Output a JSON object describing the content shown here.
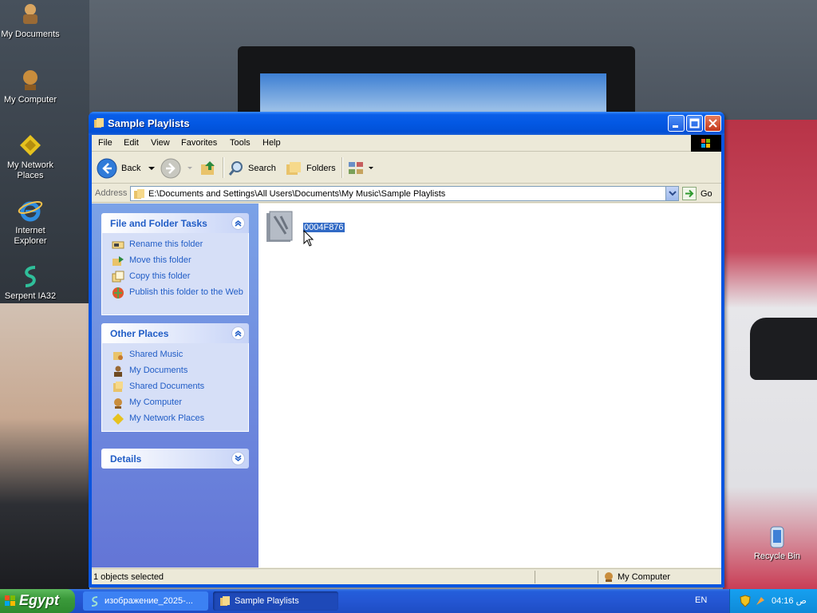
{
  "desktop": {
    "icons": [
      {
        "label": "My Documents",
        "icon": "my-documents-icon"
      },
      {
        "label": "My Computer",
        "icon": "my-computer-icon"
      },
      {
        "label": "My Network Places",
        "icon": "network-places-icon"
      },
      {
        "label": "Internet Explorer",
        "icon": "internet-explorer-icon"
      },
      {
        "label": "Serpent IA32",
        "icon": "serpent-icon"
      },
      {
        "label": "Recycle Bin",
        "icon": "recycle-bin-icon"
      }
    ]
  },
  "window": {
    "title": "Sample Playlists",
    "menu": [
      "File",
      "Edit",
      "View",
      "Favorites",
      "Tools",
      "Help"
    ],
    "toolbar": {
      "back": "Back",
      "search": "Search",
      "folders": "Folders"
    },
    "address": {
      "label": "Address",
      "value": "E:\\Documents and Settings\\All Users\\Documents\\My Music\\Sample Playlists",
      "go": "Go"
    },
    "tasks_panel": {
      "title": "File and Folder Tasks",
      "items": [
        "Rename this folder",
        "Move this folder",
        "Copy this folder",
        "Publish this folder to the Web"
      ]
    },
    "places_panel": {
      "title": "Other Places",
      "items": [
        "Shared Music",
        "My Documents",
        "Shared Documents",
        "My Computer",
        "My Network Places"
      ]
    },
    "details_panel": {
      "title": "Details"
    },
    "files": [
      {
        "name": "0004F876",
        "selected": true
      }
    ],
    "status": {
      "left": "1 objects selected",
      "right": "My Computer"
    }
  },
  "taskbar": {
    "start": "Egypt",
    "tasks": [
      "изображение_2025-...",
      "Sample Playlists"
    ],
    "language": "EN",
    "clock": "ص 04:16"
  },
  "colors": {
    "titlebar": "#0358e3",
    "left_pane": "#6f8ce0",
    "panel_title": "#215dc6",
    "selection": "#316ac5",
    "taskbar": "#245edb",
    "start": "#3b9a3b"
  }
}
